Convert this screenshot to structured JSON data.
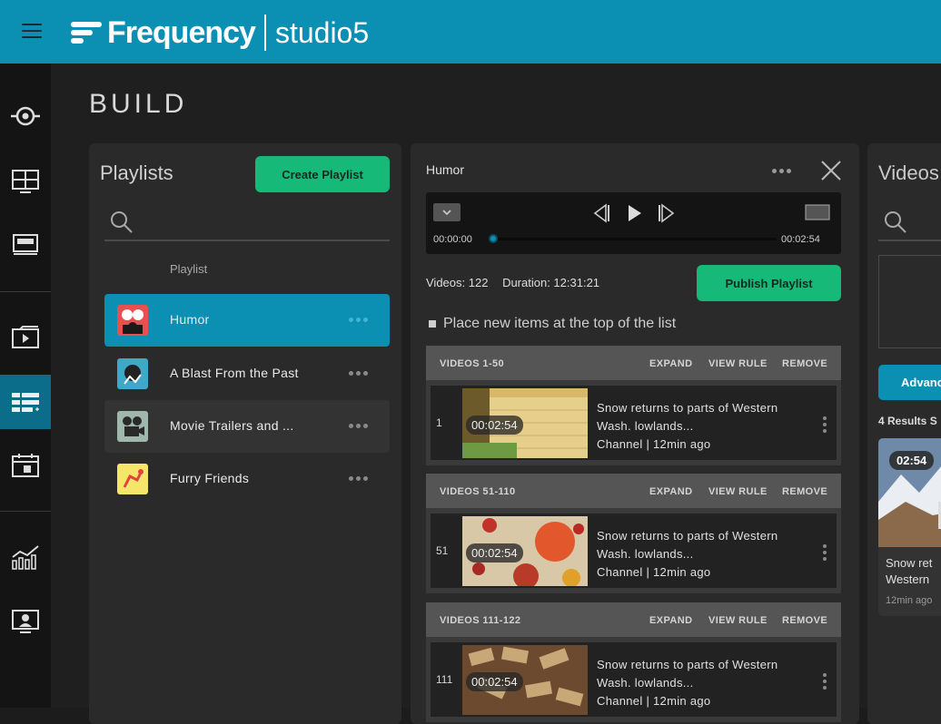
{
  "app": {
    "brand": "Frequency",
    "product": "studio",
    "version": "5"
  },
  "page": {
    "title": "BUILD"
  },
  "playlists": {
    "title": "Playlists",
    "create_label": "Create Playlist",
    "column_header": "Playlist",
    "items": [
      {
        "name": "Humor",
        "active": true
      },
      {
        "name": "A Blast From the Past",
        "active": false
      },
      {
        "name": "Movie Trailers and ...",
        "active": false
      },
      {
        "name": "Furry Friends",
        "active": false
      }
    ]
  },
  "editor": {
    "title": "Humor",
    "player": {
      "current_time": "00:00:00",
      "total_time": "00:02:54",
      "progress_fraction": 0.0
    },
    "videos_label": "Videos: 122",
    "duration_label": "Duration: 12:31:21",
    "publish_label": "Publish Playlist",
    "place_new_label": "Place new items at the top of the list",
    "groups": [
      {
        "title": "VIDEOS 1-50",
        "expand": "EXPAND",
        "view_rule": "VIEW RULE",
        "remove": "REMOVE",
        "video": {
          "index": "1",
          "duration": "00:02:54",
          "line1": "Snow returns to parts of Western",
          "line2": "Wash. lowlands...",
          "line3": "Channel | 12min ago"
        }
      },
      {
        "title": "VIDEOS 51-110",
        "expand": "EXPAND",
        "view_rule": "VIEW RULE",
        "remove": "REMOVE",
        "video": {
          "index": "51",
          "duration": "00:02:54",
          "line1": "Snow returns to parts of Western",
          "line2": "Wash. lowlands...",
          "line3": "Channel | 12min ago"
        }
      },
      {
        "title": "VIDEOS 111-122",
        "expand": "EXPAND",
        "view_rule": "VIEW RULE",
        "remove": "REMOVE",
        "video": {
          "index": "111",
          "duration": "00:02:54",
          "line1": "Snow returns to parts of Western",
          "line2": "Wash. lowlands...",
          "line3": "Channel | 12min ago"
        }
      }
    ]
  },
  "videos_panel": {
    "title": "Videos",
    "advanced_label": "Advanced",
    "results_label": "4 Results S",
    "card": {
      "duration": "02:54",
      "line1": "Snow ret",
      "line2": "Western",
      "line3": "12min ago"
    }
  },
  "colors": {
    "brand_blue": "#0b8fb3",
    "green": "#17b978",
    "sidebar": "#141414",
    "panel": "#2a2a2a"
  }
}
